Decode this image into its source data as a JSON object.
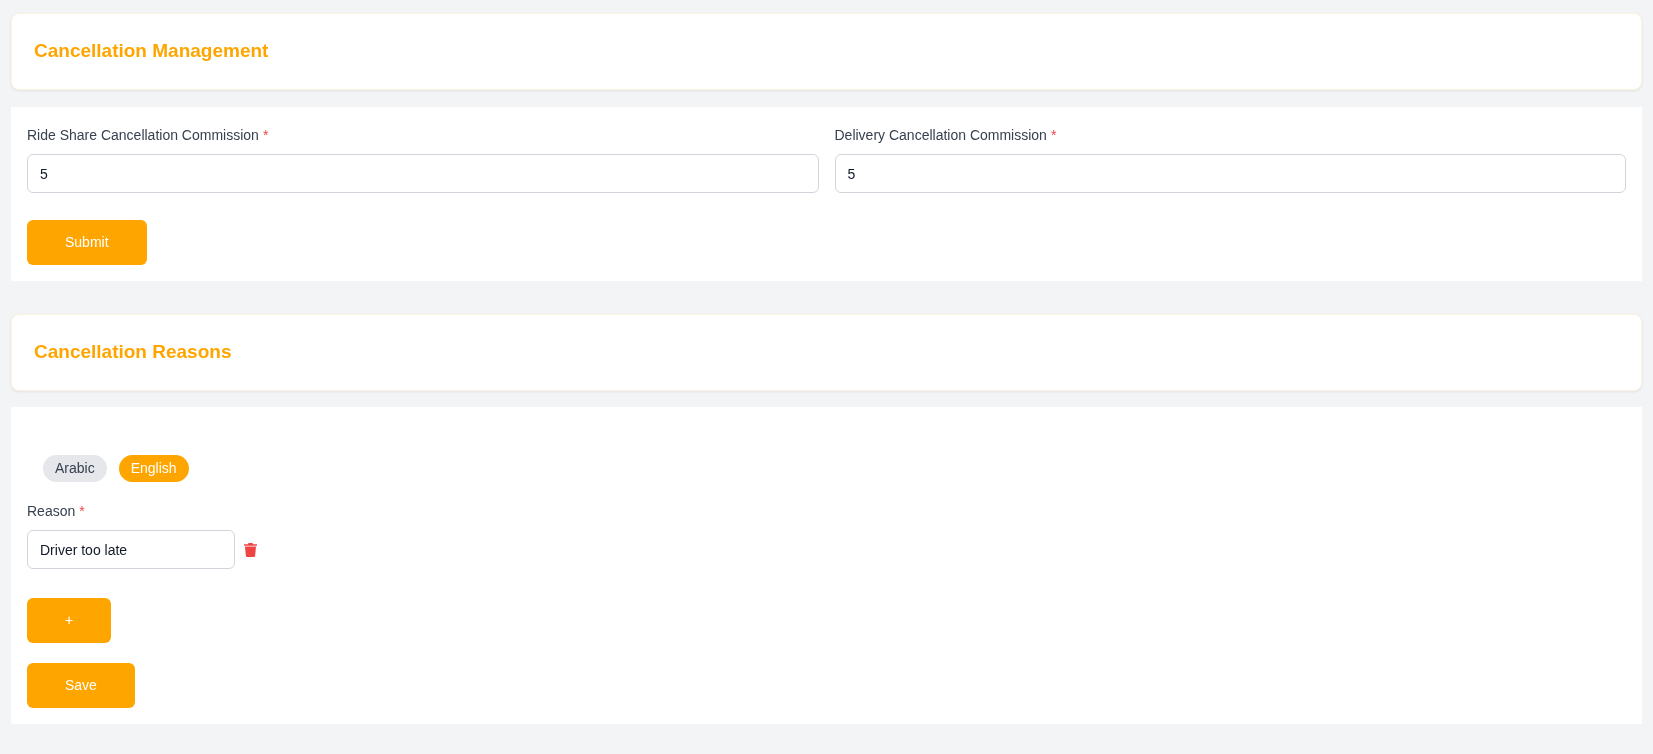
{
  "commission_header": {
    "title": "Cancellation Management"
  },
  "commission_form": {
    "fields": [
      {
        "label": "Ride Share Cancellation Commission",
        "required_mark": "*",
        "value": "5"
      },
      {
        "label": "Delivery Cancellation Commission",
        "required_mark": "*",
        "value": "5"
      }
    ],
    "submit_button": "Submit"
  },
  "reasons_header": {
    "title": "Cancellation Reasons"
  },
  "reasons_form": {
    "language_tabs": [
      {
        "label": "Arabic",
        "selected": false
      },
      {
        "label": "English",
        "selected": true
      }
    ],
    "reason_label": "Reason",
    "required_mark": "*",
    "reasons": [
      {
        "value": "Driver too late"
      }
    ],
    "add_button": "+",
    "save_button": "Save"
  }
}
